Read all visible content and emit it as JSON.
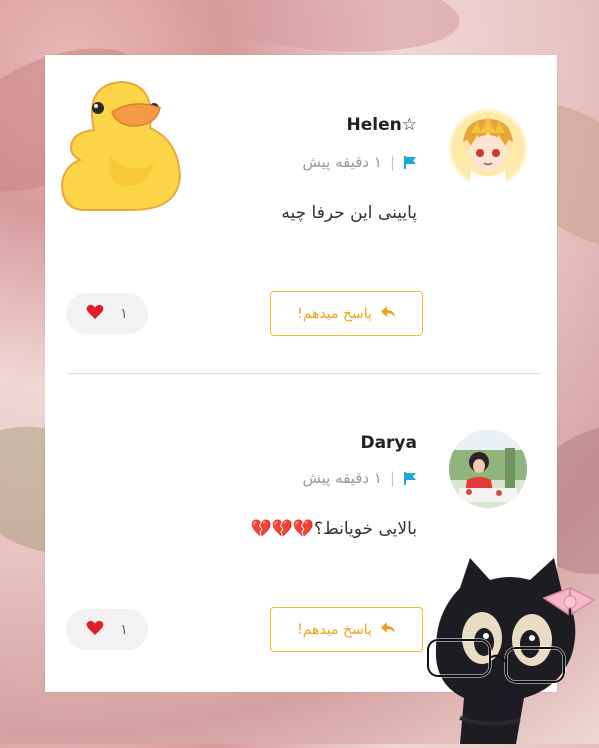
{
  "comments": [
    {
      "username": "Helen☆",
      "time": "۱ دقیقه پیش",
      "text": "پایینی این حرفا چیه",
      "reply_label": "پاسخ میدهم!",
      "likes": "۱"
    },
    {
      "username": "Darya",
      "time": "۱ دقیقه پیش",
      "text": "بالایی خویانط؟💔💔💔",
      "reply_label": "پاسخ میدهم!",
      "likes": "۱"
    }
  ],
  "icons": {
    "flag": "flag-icon",
    "reply": "reply-arrow-icon",
    "like": "heart-icon"
  },
  "colors": {
    "accent": "#f5b92d",
    "flag": "#1ea7d8",
    "heart": "#e01e2c"
  }
}
